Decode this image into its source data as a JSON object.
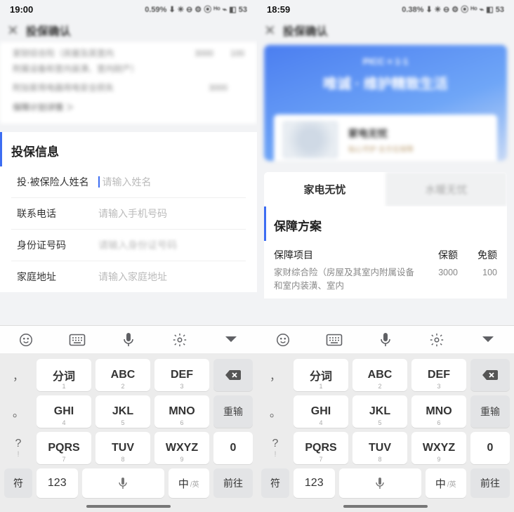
{
  "left": {
    "status": {
      "time": "19:00",
      "right": "0.59% ⬇  ✳ ⊖ ⚙ ⦿ ᴴᵒ ⌁ ◧ 53"
    },
    "title": "投保确认",
    "blur": {
      "line1": "家财综合险（房屋及其室内",
      "line1b": "附属设备和室内装潢、室内财产）",
      "v1a": "3000",
      "v1b": "100",
      "line2": "附加家用电器用电安全损失",
      "v2": "3000",
      "line3": "保障计划详情 ＞"
    },
    "section": "投保信息",
    "fields": {
      "name_label": "投·被保险人姓名",
      "name_ph": "请输入姓名",
      "phone_label": "联系电话",
      "phone_ph": "请输入手机号码",
      "id_label": "身份证号码",
      "id_ph": "请输入身份证号码",
      "addr_label": "家庭地址",
      "addr_ph": "请输入家庭地址"
    }
  },
  "right": {
    "status": {
      "time": "18:59",
      "right": "0.38% ⬇  ✳ ⊖ ⚙ ⦿ ᴴᵒ ⌁ ◧ 53"
    },
    "title": "投保确认",
    "banner": {
      "brand": "PICC × 1·1",
      "slogan": "唯诚 · 维护精致生活",
      "card_title": "家电无忧",
      "card_sub": "贴心守护   全方位保障"
    },
    "tabs": {
      "active": "家电无忧",
      "inactive": "水暖无忧"
    },
    "section": "保障方案",
    "table": {
      "h1": "保障项目",
      "h2": "保额",
      "h3": "免额",
      "r1c1": "家财综合险（房屋及其室内附属设备和室内装潢、室内",
      "r1c2": "3000",
      "r1c3": "100"
    }
  },
  "keyboard": {
    "side": {
      "comma": "，",
      "period": "。",
      "q": "?",
      "ex": "!"
    },
    "keys": {
      "k1": "分词",
      "k2": "ABC",
      "k3": "DEF",
      "k4": "GHI",
      "k5": "JKL",
      "k6": "MNO",
      "k7": "PQRS",
      "k8": "TUV",
      "k9": "WXYZ",
      "k0": "0"
    },
    "subs": {
      "s1": "1",
      "s2": "2",
      "s3": "3",
      "s4": "4",
      "s5": "5",
      "s6": "6",
      "s7": "7",
      "s8": "8",
      "s9": "9"
    },
    "func": {
      "reenter": "重输",
      "sym": "符",
      "num": "123",
      "lang_main": "中",
      "lang_sub": "/英",
      "go": "前往"
    }
  }
}
